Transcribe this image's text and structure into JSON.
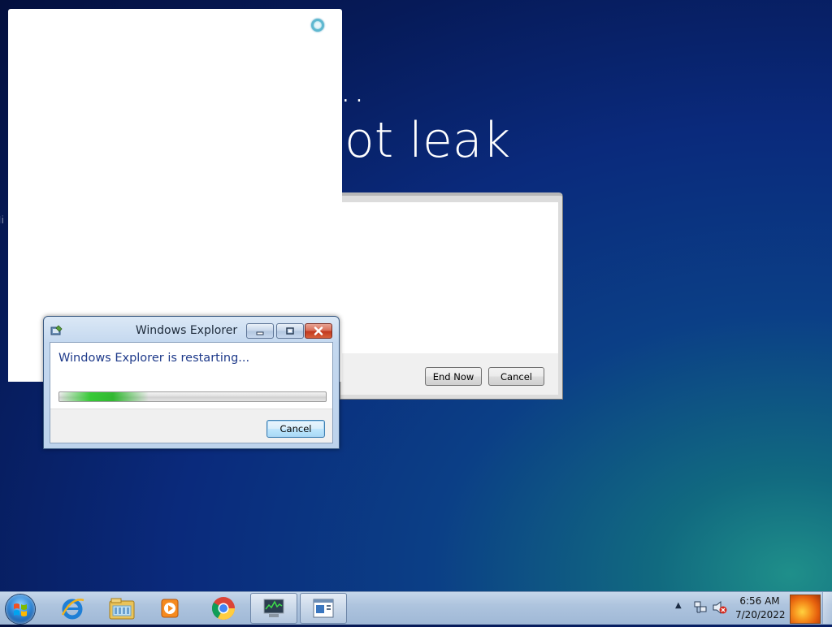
{
  "background": {
    "ellipsis": "..",
    "headline": "ot leak",
    "partial_text": "Ji"
  },
  "explorer_dialog": {
    "title": "Windows Explorer",
    "message": "Windows Explorer is restarting...",
    "cancel_label": "Cancel",
    "progress_indeterminate": true
  },
  "endnow_dialog": {
    "end_now_label": "End Now",
    "cancel_label": "Cancel"
  },
  "taskbar": {
    "apps": [
      {
        "name": "internet-explorer-icon"
      },
      {
        "name": "windows-explorer-icon"
      },
      {
        "name": "media-player-icon"
      },
      {
        "name": "chrome-icon"
      },
      {
        "name": "task-manager-icon",
        "active": true
      },
      {
        "name": "notepad-window-icon",
        "active": true
      }
    ],
    "clock_time": "6:56 AM",
    "clock_date": "7/20/2022"
  },
  "colors": {
    "message_text": "#1e3a8a",
    "progress_green": "#2dc82d",
    "close_button_red": "#c2391f"
  }
}
